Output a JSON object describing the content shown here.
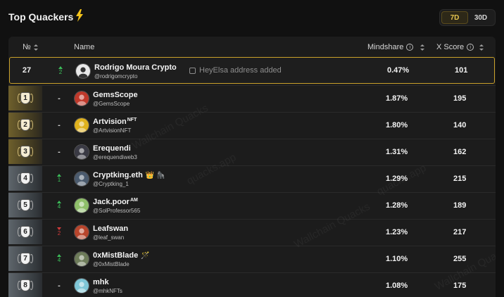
{
  "header": {
    "title": "Top Quackers",
    "bolt_icon": "lightning-icon",
    "periods": [
      {
        "label": "7D",
        "active": true
      },
      {
        "label": "30D",
        "active": false
      }
    ]
  },
  "columns": {
    "rank": "№",
    "name": "Name",
    "mindshare": "Mindshare",
    "xscore": "X Score"
  },
  "watermark": {
    "text_a": "Wallchain Quacks",
    "text_b": "quacks.app"
  },
  "current_user": {
    "rank": "27",
    "delta": "2",
    "delta_dir": "up",
    "name": "Rodrigo Moura Crypto",
    "handle": "@rodrigomcrypto",
    "note": "HeyElsa address added",
    "mindshare": "0.47%",
    "xscore": "101"
  },
  "rows": [
    {
      "rank": "1",
      "tier": "gold",
      "delta": "-",
      "delta_dir": "flat",
      "name": "GemsScope",
      "tag": "",
      "emoji": "",
      "handle": "@GemsScope",
      "mindshare": "1.87%",
      "xscore": "195",
      "avatar_color": "#c0392b"
    },
    {
      "rank": "2",
      "tier": "gold",
      "delta": "-",
      "delta_dir": "flat",
      "name": "Artvision",
      "tag": "NFT",
      "emoji": "",
      "handle": "@ArtvisionNFT",
      "mindshare": "1.80%",
      "xscore": "140",
      "avatar_color": "#e0b21e"
    },
    {
      "rank": "3",
      "tier": "gold",
      "delta": "-",
      "delta_dir": "flat",
      "name": "Erequendi",
      "tag": "",
      "emoji": "",
      "handle": "@erequendiweb3",
      "mindshare": "1.31%",
      "xscore": "162",
      "avatar_color": "#3a3a44"
    },
    {
      "rank": "4",
      "tier": "silver",
      "delta": "1",
      "delta_dir": "up",
      "name": "Cryptking.eth",
      "tag": "",
      "emoji": "👑 🦍",
      "handle": "@Cryptking_1",
      "mindshare": "1.29%",
      "xscore": "215",
      "avatar_color": "#4b5b6e"
    },
    {
      "rank": "5",
      "tier": "silver",
      "delta": "4",
      "delta_dir": "up",
      "name": "Jack.poor",
      "tag": "AM",
      "emoji": "",
      "handle": "@SolProfessor565",
      "mindshare": "1.28%",
      "xscore": "189",
      "avatar_color": "#8fbf6a"
    },
    {
      "rank": "6",
      "tier": "silver",
      "delta": "2",
      "delta_dir": "down",
      "name": "Leafswan",
      "tag": "",
      "emoji": "",
      "handle": "@leaf_swan",
      "mindshare": "1.23%",
      "xscore": "217",
      "avatar_color": "#b8452c"
    },
    {
      "rank": "7",
      "tier": "silver",
      "delta": "4",
      "delta_dir": "up",
      "name": "0xMistBlade",
      "tag": "",
      "emoji": "🪄",
      "handle": "@0xMistBlade",
      "mindshare": "1.10%",
      "xscore": "255",
      "avatar_color": "#6e7c5a"
    },
    {
      "rank": "8",
      "tier": "silver",
      "delta": "-",
      "delta_dir": "flat",
      "name": "mhk",
      "tag": "",
      "emoji": "",
      "handle": "@mhkNFTs",
      "mindshare": "1.08%",
      "xscore": "175",
      "avatar_color": "#7fc6d6"
    }
  ]
}
